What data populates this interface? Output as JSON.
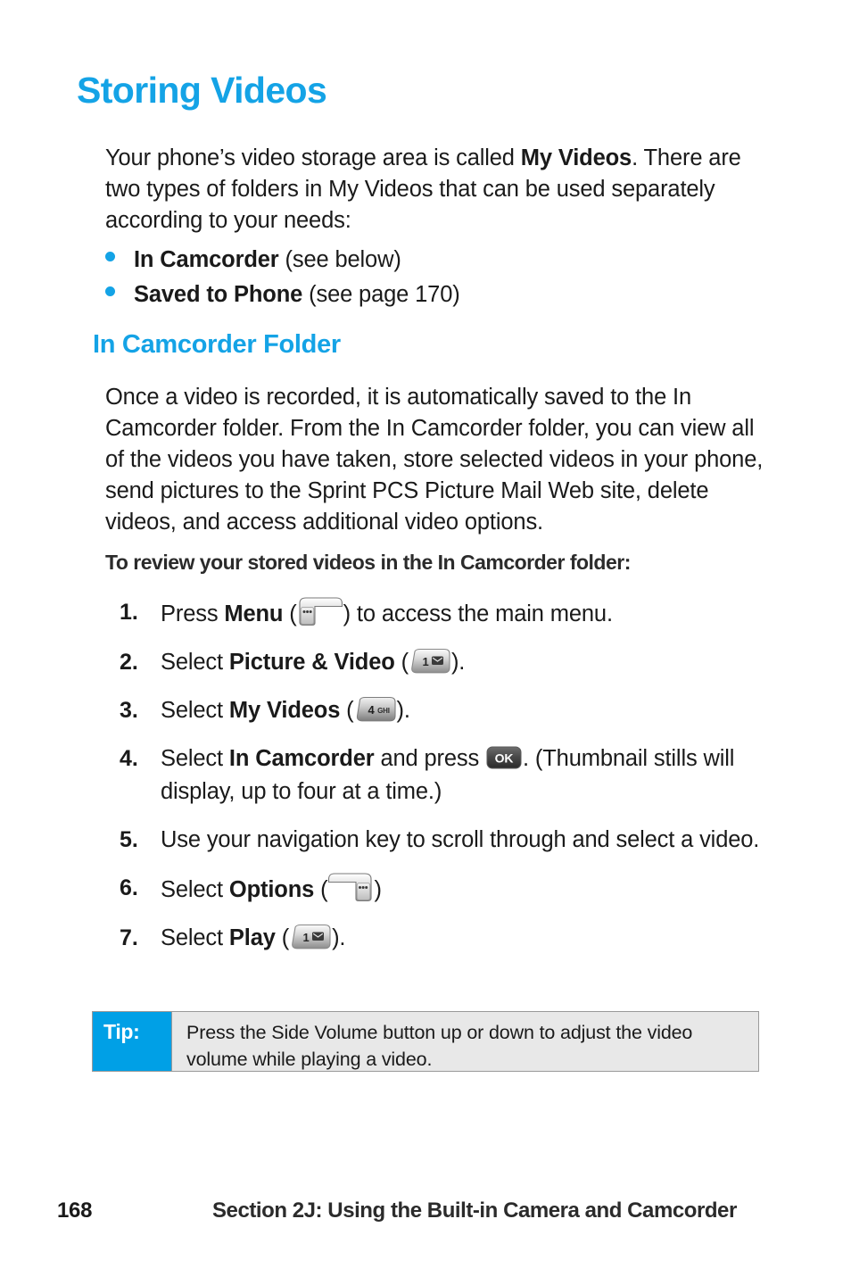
{
  "document": {
    "page_title": "Storing Videos",
    "section_heading": "In Camcorder Folder"
  },
  "intro": {
    "before_bold": "Your phone’s video storage area is called ",
    "bold": "My Videos",
    "after_bold": ". There are two types of folders in My Videos that can be used separately according to your needs:"
  },
  "bullets": [
    {
      "bold": "In Camcorder",
      "rest": " (see below)"
    },
    {
      "bold": "Saved to Phone",
      "rest": " (see page 170)"
    }
  ],
  "body_paragraph": "Once a video is recorded, it is automatically saved to the In Camcorder folder. From the In Camcorder folder, you can view all of the videos you have taken, store selected videos in your phone, send pictures to the Sprint PCS Picture Mail Web site, delete videos, and access additional video options.",
  "procedure": {
    "header": "To review your stored videos in the In Camcorder folder:",
    "steps": [
      {
        "number": "1.",
        "pre": "Press ",
        "bold": "Menu",
        "mid": " (",
        "icon": "left-softkey-icon",
        "post": ") to access the main menu."
      },
      {
        "number": "2.",
        "pre": "Select ",
        "bold": "Picture & Video",
        "mid": " (",
        "icon": "key-1-icon",
        "post": ")."
      },
      {
        "number": "3.",
        "pre": "Select ",
        "bold": "My Videos",
        "mid": " (",
        "icon": "key-4-ghi-icon",
        "post": ")."
      },
      {
        "number": "4.",
        "pre": "Select ",
        "bold": "In Camcorder",
        "mid": " and press ",
        "icon": "ok-key-icon",
        "post": ". (Thumbnail stills will display, up to four at a time.)"
      },
      {
        "number": "5.",
        "pre": "Use your navigation key to scroll through and select a video.",
        "bold": "",
        "mid": "",
        "icon": "",
        "post": ""
      },
      {
        "number": "6.",
        "pre": "Select ",
        "bold": "Options",
        "mid": " (",
        "icon": "right-softkey-icon",
        "post": ")"
      },
      {
        "number": "7.",
        "pre": "Select ",
        "bold": "Play",
        "mid": " (",
        "icon": "key-1-icon",
        "post": ")."
      }
    ]
  },
  "key_icons": {
    "key_1_digit": "1",
    "key_4_digit": "4",
    "key_4_letters": "GHI",
    "ok_label": "OK"
  },
  "tip": {
    "label": "Tip:",
    "text": "Press the Side Volume button up or down to adjust the video volume while playing a video."
  },
  "footer": {
    "page_number": "168",
    "section_text": "Section 2J: Using the Built-in Camera and Camcorder"
  },
  "colors": {
    "heading_blue": "#14a3e6",
    "tip_blue": "#00a0e6",
    "tip_body_gray": "#e8e8e8",
    "text_black": "#1a1a1a"
  }
}
